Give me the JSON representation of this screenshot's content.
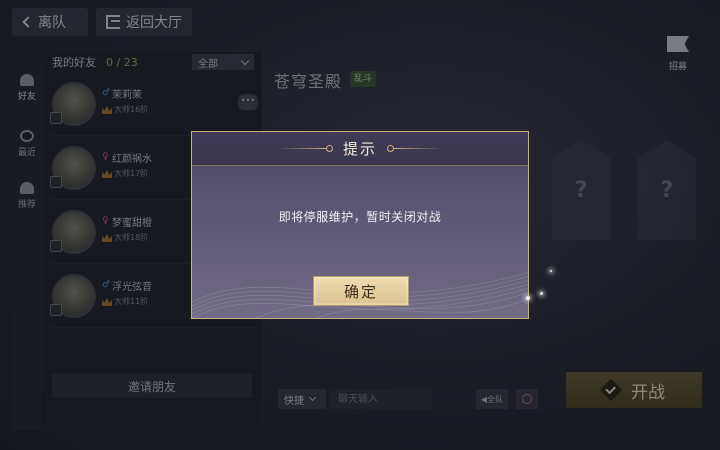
{
  "nav": {
    "leave_label": "离队",
    "lobby_label": "返回大厅"
  },
  "side_tabs": [
    {
      "label": "好友"
    },
    {
      "label": "最近"
    },
    {
      "label": "推荐"
    }
  ],
  "friends": {
    "header_label": "我的好友",
    "count": "0 / 23",
    "filter_label": "全部",
    "rows": [
      {
        "name": "茉莉茉",
        "rank": "大师16阶",
        "gender": "♂"
      },
      {
        "name": "红颜祸水",
        "rank": "大师17阶",
        "gender": "♀"
      },
      {
        "name": "梦蜜甜橙",
        "rank": "大师18阶",
        "gender": "♀"
      },
      {
        "name": "浮光弦音",
        "rank": "大师11阶",
        "gender": "♂"
      }
    ],
    "invite_label": "邀请朋友"
  },
  "room": {
    "title": "苍穹圣殿",
    "mode_tag": "乱斗",
    "seat_placeholder": "?",
    "flag_label": "招募"
  },
  "chat": {
    "quick_label": "快捷",
    "input_placeholder": "聊天输入",
    "all_label": "全队"
  },
  "start": {
    "label": "开战"
  },
  "dialog": {
    "title": "提示",
    "message": "即将停服维护，暂时关闭对战",
    "confirm_label": "确定"
  },
  "colors": {
    "accent_gold": "#c7b07a",
    "dialog_bg": "#5c5775",
    "confirm_bg": "#e6d0a1"
  }
}
